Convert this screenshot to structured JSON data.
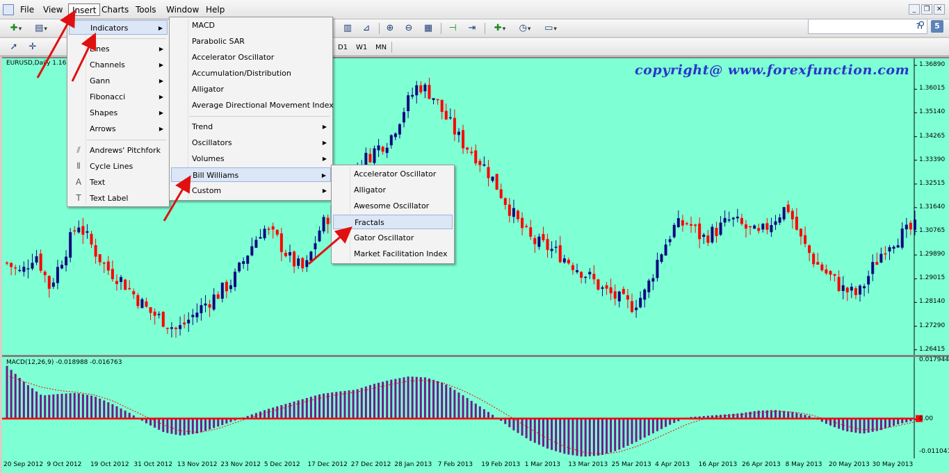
{
  "colors": {
    "chart_bg": "#7effd4",
    "bull_candle": "#0a0a7d",
    "bear_candle": "#ff0000",
    "macd_hist": "#6b1e88",
    "macd_signal": "#ff0000",
    "watermark": "#2a35c8",
    "annotation_arrow": "#e01010"
  },
  "menubar": {
    "items": [
      {
        "label": "File"
      },
      {
        "label": "View"
      },
      {
        "label": "Insert",
        "active": true
      },
      {
        "label": "Charts"
      },
      {
        "label": "Tools"
      },
      {
        "label": "Window"
      },
      {
        "label": "Help"
      }
    ],
    "window_buttons": [
      "minimize-icon",
      "restore-icon",
      "close-icon"
    ]
  },
  "toolbar": {
    "timeframes": [
      "D1",
      "W1",
      "MN"
    ],
    "icons": [
      "new-chart-icon",
      "profiles-icon",
      "line-chart-icon",
      "period-separators-icon",
      "zoom-in-icon",
      "zoom-out-icon",
      "tile-windows-icon",
      "chart-shift-icon",
      "autoscroll-icon",
      "indicators-icon",
      "periodicity-icon",
      "templates-icon",
      "cursor-icon",
      "crosshair-icon"
    ],
    "search_placeholder": ""
  },
  "chart": {
    "label": "EURUSD,Daily  1.16",
    "watermark": "copyright@ www.forexfunction.com",
    "macd_label": "MACD(12,26,9) -0.018988 -0.016763"
  },
  "menus": {
    "insert": [
      {
        "label": "Indicators",
        "submenu": true,
        "highlight": true,
        "icon": ""
      },
      {
        "separator": true
      },
      {
        "label": "Lines",
        "submenu": true,
        "icon": ""
      },
      {
        "label": "Channels",
        "submenu": true,
        "icon": ""
      },
      {
        "label": "Gann",
        "submenu": true,
        "icon": ""
      },
      {
        "label": "Fibonacci",
        "submenu": true,
        "icon": ""
      },
      {
        "label": "Shapes",
        "submenu": true,
        "icon": ""
      },
      {
        "label": "Arrows",
        "submenu": true,
        "icon": ""
      },
      {
        "separator": true
      },
      {
        "label": "Andrews' Pitchfork",
        "icon": "pitchfork-icon"
      },
      {
        "label": "Cycle Lines",
        "icon": "cycle-lines-icon"
      },
      {
        "label": "Text",
        "icon": "text-icon"
      },
      {
        "label": "Text Label",
        "icon": "text-label-icon"
      }
    ],
    "indicators": [
      {
        "label": "MACD"
      },
      {
        "label": "Parabolic SAR"
      },
      {
        "label": "Accelerator Oscillator"
      },
      {
        "label": "Accumulation/Distribution"
      },
      {
        "label": "Alligator"
      },
      {
        "label": "Average Directional Movement Index"
      },
      {
        "separator": true
      },
      {
        "label": "Trend",
        "submenu": true
      },
      {
        "label": "Oscillators",
        "submenu": true
      },
      {
        "label": "Volumes",
        "submenu": true
      },
      {
        "label": "Bill Williams",
        "submenu": true,
        "highlight": true
      },
      {
        "label": "Custom",
        "submenu": true
      }
    ],
    "bill_williams": [
      {
        "label": "Accelerator Oscillator"
      },
      {
        "label": "Alligator"
      },
      {
        "label": "Awesome Oscillator"
      },
      {
        "label": "Fractals",
        "highlight": true
      },
      {
        "label": "Gator Oscillator"
      },
      {
        "label": "Market Facilitation Index"
      }
    ]
  },
  "chart_data": [
    {
      "type": "candlestick",
      "title": "EURUSD,Daily",
      "y_ticks": [
        1.3689,
        1.3601,
        1.3514,
        1.3426,
        1.3339,
        1.3251,
        1.3164,
        1.3076,
        1.2989,
        1.2901,
        1.2814,
        1.2726,
        1.2639
      ],
      "y_tick_labels": [
        "1.36890",
        "1.36015",
        "1.35140",
        "1.34265",
        "1.33390",
        "1.32515",
        "1.31640",
        "1.30765",
        "1.29890",
        "1.29015",
        "1.28140",
        "1.27290",
        "1.26415"
      ],
      "ylim": [
        1.262,
        1.3715
      ],
      "x_tick_labels": [
        "20 Sep 2012",
        "9 Oct 2012",
        "19 Oct 2012",
        "31 Oct 2012",
        "13 Nov 2012",
        "23 Nov 2012",
        "5 Dec 2012",
        "17 Dec 2012",
        "27 Dec 2012",
        "28 Jan 2013",
        "7 Feb 2013",
        "19 Feb 2013",
        "1 Mar 2013",
        "13 Mar 2013",
        "25 Mar 2013",
        "4 Apr 2013",
        "16 Apr 2013",
        "26 Apr 2013",
        "8 May 2013",
        "20 May 2013",
        "30 May 2013"
      ],
      "close_path": [
        1.296,
        1.292,
        1.3,
        1.287,
        1.299,
        1.311,
        1.302,
        1.294,
        1.29,
        1.284,
        1.278,
        1.275,
        1.271,
        1.276,
        1.281,
        1.285,
        1.29,
        1.3,
        1.309,
        1.305,
        1.297,
        1.293,
        1.308,
        1.316,
        1.323,
        1.333,
        1.338,
        1.342,
        1.353,
        1.362,
        1.358,
        1.349,
        1.341,
        1.336,
        1.329,
        1.32,
        1.311,
        1.304,
        1.302,
        1.299,
        1.295,
        1.291,
        1.286,
        1.283,
        1.28,
        1.285,
        1.299,
        1.309,
        1.311,
        1.305,
        1.308,
        1.312,
        1.309,
        1.306,
        1.312,
        1.317,
        1.304,
        1.296,
        1.291,
        1.286,
        1.284,
        1.294,
        1.303,
        1.306,
        1.309
      ]
    },
    {
      "type": "bar",
      "title": "MACD(12,26,9) -0.018988 -0.016763",
      "y_tick_labels": [
        "0.017944",
        "0.00",
        "-0.011041"
      ],
      "ylim": [
        -0.0121,
        0.0187
      ],
      "histogram_path": [
        0.016,
        0.011,
        0.007,
        0.0075,
        0.0078,
        0.0068,
        0.0045,
        0.0018,
        -0.0015,
        -0.0042,
        -0.0052,
        -0.0044,
        -0.0026,
        -0.0007,
        0.0012,
        0.003,
        0.0045,
        0.006,
        0.0075,
        0.0082,
        0.0088,
        0.0105,
        0.0118,
        0.0128,
        0.0125,
        0.0108,
        0.0075,
        0.004,
        0.0005,
        -0.0035,
        -0.0068,
        -0.0092,
        -0.0108,
        -0.0116,
        -0.0112,
        -0.0096,
        -0.0072,
        -0.0045,
        -0.0018,
        0.0004,
        0.0008,
        0.0012,
        0.0016,
        0.0024,
        0.0026,
        0.002,
        0.0008,
        -0.0018,
        -0.0038,
        -0.0046,
        -0.0036,
        -0.0018,
        -0.0005
      ],
      "signal_path": [
        0.013,
        0.0112,
        0.0095,
        0.0085,
        0.008,
        0.0072,
        0.0055,
        0.003,
        0.0005,
        -0.002,
        -0.0038,
        -0.0042,
        -0.0032,
        -0.0014,
        0.0004,
        0.002,
        0.0035,
        0.005,
        0.0063,
        0.0073,
        0.008,
        0.0092,
        0.0104,
        0.0114,
        0.0116,
        0.0108,
        0.0088,
        0.0062,
        0.0032,
        0,
        -0.0032,
        -0.0062,
        -0.0086,
        -0.0102,
        -0.0108,
        -0.0102,
        -0.0086,
        -0.0064,
        -0.004,
        -0.0016,
        0,
        0.0008,
        0.0012,
        0.0018,
        0.0022,
        0.002,
        0.0012,
        -0.0004,
        -0.0022,
        -0.0034,
        -0.0032,
        -0.0022,
        -0.001
      ]
    }
  ]
}
